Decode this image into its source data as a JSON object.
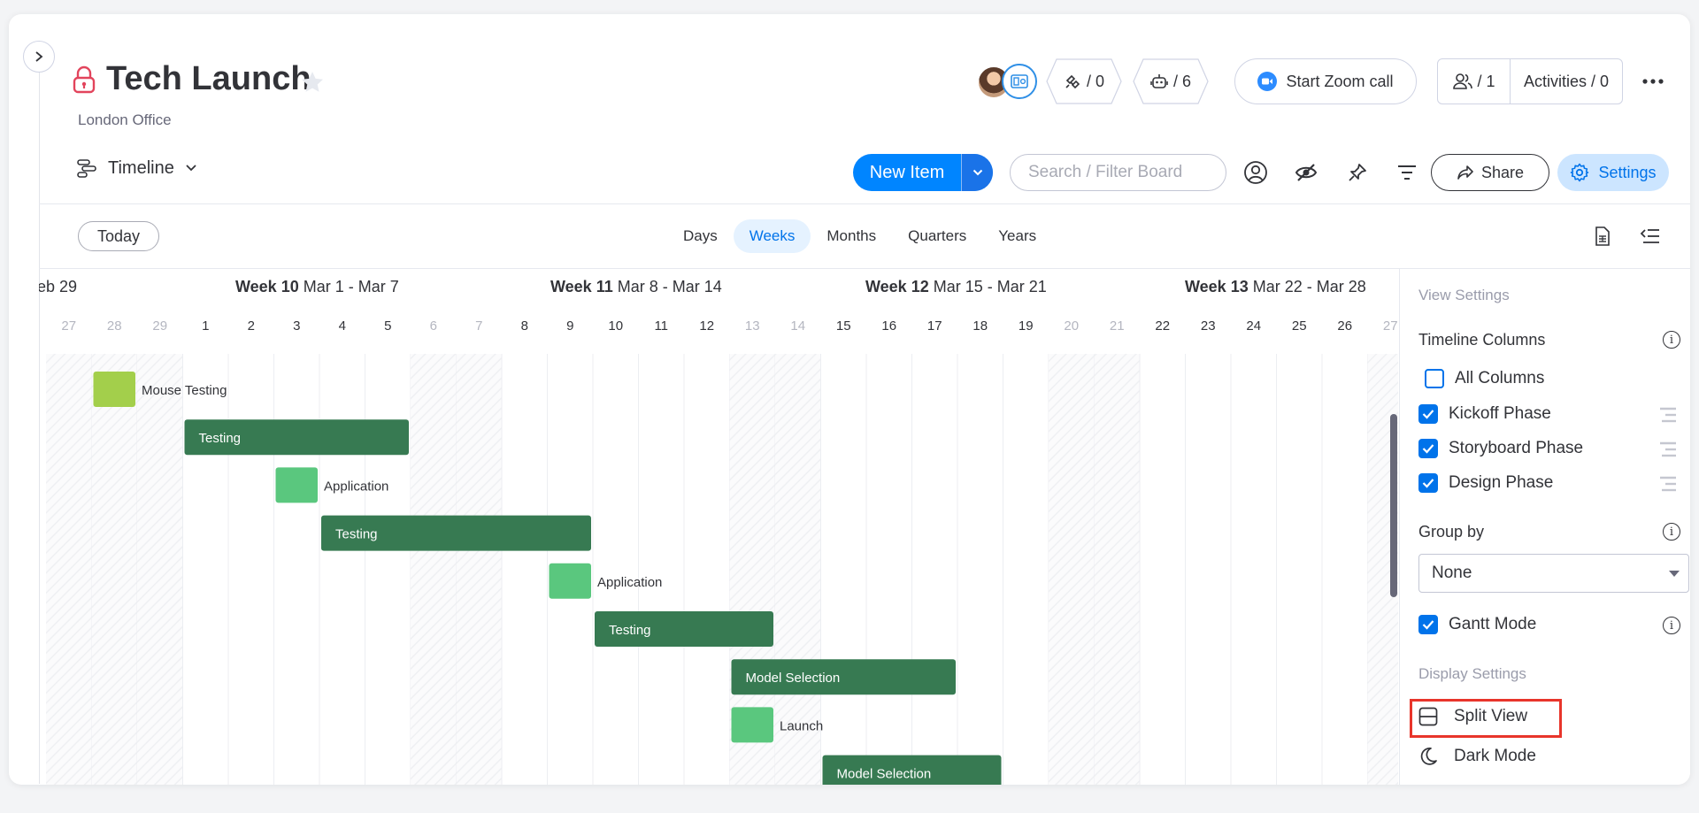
{
  "board": {
    "title": "Tech Launch",
    "subtitle": "London Office"
  },
  "header": {
    "integrations_count": "/ 0",
    "automations_count": "/ 6",
    "zoom_label": "Start Zoom call",
    "members_count": "/ 1",
    "activities_label": "Activities / 0"
  },
  "toolbar": {
    "view_label": "Timeline",
    "new_item_label": "New Item",
    "search_placeholder": "Search / Filter Board",
    "share_label": "Share",
    "settings_label": "Settings"
  },
  "timeline_controls": {
    "today_label": "Today",
    "scales": [
      {
        "label": "Days",
        "active": false
      },
      {
        "label": "Weeks",
        "active": true
      },
      {
        "label": "Months",
        "active": false
      },
      {
        "label": "Quarters",
        "active": false
      },
      {
        "label": "Years",
        "active": false
      }
    ]
  },
  "timeline": {
    "weeks": [
      {
        "bold": "",
        "range": "eb 29"
      },
      {
        "bold": "Week 10",
        "range": " Mar 1 - Mar 7"
      },
      {
        "bold": "Week 11",
        "range": " Mar 8 - Mar 14"
      },
      {
        "bold": "Week 12",
        "range": " Mar 15 - Mar 21"
      },
      {
        "bold": "Week 13",
        "range": " Mar 22 - Mar 28"
      }
    ],
    "days": [
      {
        "d": "27",
        "we": true
      },
      {
        "d": "28",
        "we": true
      },
      {
        "d": "29",
        "we": true
      },
      {
        "d": "1",
        "we": false
      },
      {
        "d": "2",
        "we": false
      },
      {
        "d": "3",
        "we": false
      },
      {
        "d": "4",
        "we": false
      },
      {
        "d": "5",
        "we": false
      },
      {
        "d": "6",
        "we": true
      },
      {
        "d": "7",
        "we": true
      },
      {
        "d": "8",
        "we": false
      },
      {
        "d": "9",
        "we": false
      },
      {
        "d": "10",
        "we": false
      },
      {
        "d": "11",
        "we": false
      },
      {
        "d": "12",
        "we": false
      },
      {
        "d": "13",
        "we": true
      },
      {
        "d": "14",
        "we": true
      },
      {
        "d": "15",
        "we": false
      },
      {
        "d": "16",
        "we": false
      },
      {
        "d": "17",
        "we": false
      },
      {
        "d": "18",
        "we": false
      },
      {
        "d": "19",
        "we": false
      },
      {
        "d": "20",
        "we": true
      },
      {
        "d": "21",
        "we": true
      },
      {
        "d": "22",
        "we": false
      },
      {
        "d": "23",
        "we": false
      },
      {
        "d": "24",
        "we": false
      },
      {
        "d": "25",
        "we": false
      },
      {
        "d": "26",
        "we": false
      },
      {
        "d": "27",
        "we": true
      }
    ],
    "items": [
      {
        "name": "Mouse Testing",
        "start": 1,
        "days": 1,
        "color": "#9cd326",
        "label_inside": false
      },
      {
        "name": "Testing",
        "start": 3,
        "days": 5,
        "color": "#037f4c",
        "label_inside": true
      },
      {
        "name": "Application",
        "start": 5,
        "days": 1,
        "color": "#33d391",
        "label_inside": false
      },
      {
        "name": "Testing",
        "start": 6,
        "days": 6,
        "color": "#037f4c",
        "label_inside": true
      },
      {
        "name": "Application",
        "start": 11,
        "days": 1,
        "color": "#33d391",
        "label_inside": false
      },
      {
        "name": "Testing",
        "start": 12,
        "days": 4,
        "color": "#037f4c",
        "label_inside": true
      },
      {
        "name": "Model Selection",
        "start": 15,
        "days": 5,
        "color": "#037f4c",
        "label_inside": true
      },
      {
        "name": "Launch",
        "start": 15,
        "days": 1,
        "color": "#33d391",
        "label_inside": false
      },
      {
        "name": "Model Selection",
        "start": 17,
        "days": 4,
        "color": "#037f4c",
        "label_inside": true
      }
    ]
  },
  "panel": {
    "view_settings_label": "View Settings",
    "timeline_columns_label": "Timeline Columns",
    "all_columns_label": "All Columns",
    "columns": [
      {
        "label": "Kickoff Phase",
        "checked": true
      },
      {
        "label": "Storyboard Phase",
        "checked": true
      },
      {
        "label": "Design Phase",
        "checked": true
      }
    ],
    "group_by_label": "Group by",
    "group_by_value": "None",
    "gantt_label": "Gantt Mode",
    "display_settings_label": "Display Settings",
    "split_view_label": "Split View",
    "dark_mode_label": "Dark Mode"
  }
}
